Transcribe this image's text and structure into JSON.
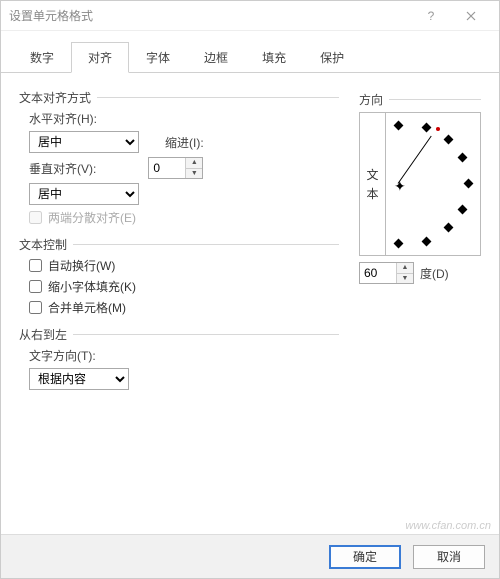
{
  "window": {
    "title": "设置单元格格式"
  },
  "tabs": {
    "t0": "数字",
    "t1": "对齐",
    "t2": "字体",
    "t3": "边框",
    "t4": "填充",
    "t5": "保护"
  },
  "align": {
    "group": "文本对齐方式",
    "h_label": "水平对齐(H):",
    "h_value": "居中",
    "indent_label": "缩进(I):",
    "indent_value": "0",
    "v_label": "垂直对齐(V):",
    "v_value": "居中",
    "justify_label": "两端分散对齐(E)"
  },
  "control": {
    "group": "文本控制",
    "wrap": "自动换行(W)",
    "shrink": "缩小字体填充(K)",
    "merge": "合并单元格(M)"
  },
  "rtl": {
    "group": "从右到左",
    "dir_label": "文字方向(T):",
    "dir_value": "根据内容"
  },
  "orient": {
    "group": "方向",
    "vert1": "文",
    "vert2": "本",
    "deg_value": "60",
    "deg_label": "度(D)"
  },
  "footer": {
    "ok": "确定",
    "cancel": "取消"
  },
  "watermark": "www.cfan.com.cn"
}
